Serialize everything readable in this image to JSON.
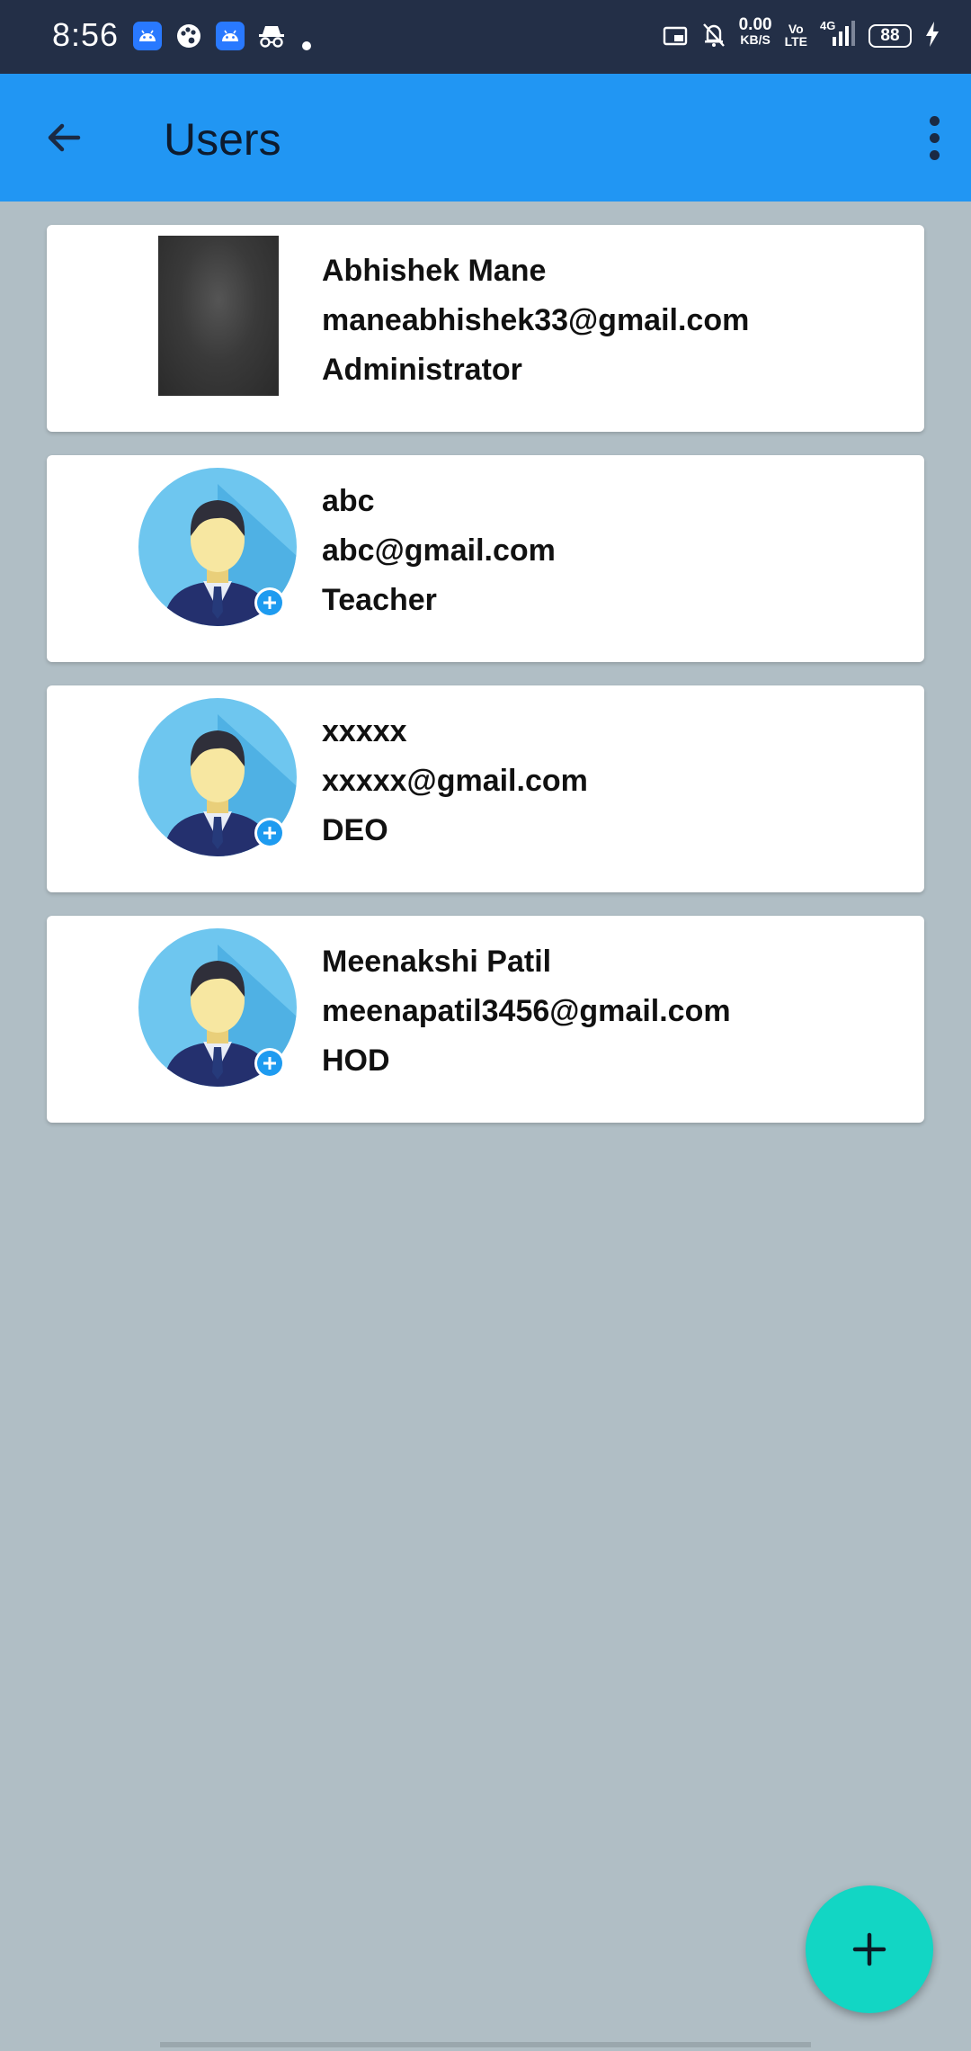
{
  "status_bar": {
    "time": "8:56",
    "net_speed_value": "0.00",
    "net_speed_unit": "KB/S",
    "volte_top": "Vo",
    "volte_bottom": "LTE",
    "network": "4G",
    "battery": "88",
    "icons": [
      "android-app-icon",
      "palette-icon",
      "android-app-icon",
      "incognito-icon",
      "dot-icon",
      "cast-icon",
      "mute-bell-icon",
      "signal-icon",
      "charging-icon"
    ]
  },
  "app_bar": {
    "title": "Users",
    "color": "#2196f3"
  },
  "users": [
    {
      "name": "Abhishek Mane",
      "email": "maneabhishek33@gmail.com",
      "role": "Administrator",
      "avatar": "photo"
    },
    {
      "name": "abc",
      "email": "abc@gmail.com",
      "role": "Teacher",
      "avatar": "default-user-icon"
    },
    {
      "name": "xxxxx",
      "email": "xxxxx@gmail.com",
      "role": "DEO",
      "avatar": "default-user-icon"
    },
    {
      "name": "Meenakshi Patil",
      "email": "meenapatil3456@gmail.com",
      "role": "HOD",
      "avatar": "default-user-icon"
    }
  ],
  "fab": {
    "icon": "plus-icon",
    "color": "#12d6c4"
  },
  "background_color": "#b0bec5"
}
